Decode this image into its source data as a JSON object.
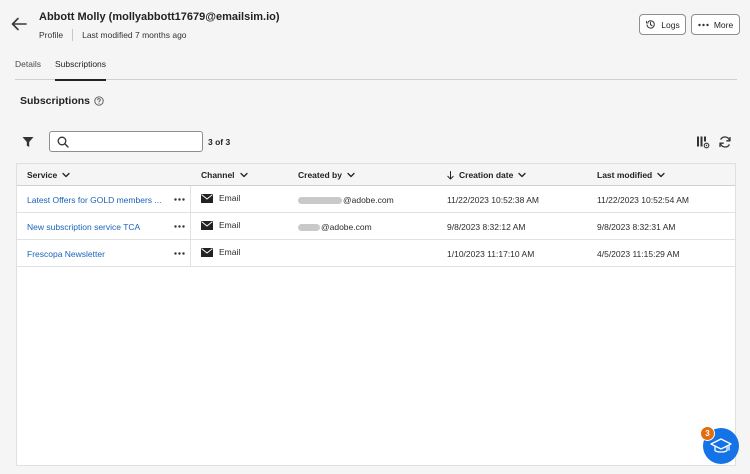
{
  "header": {
    "title": "Abbott Molly (mollyabbott17679@emailsim.io)",
    "breadcrumb": "Profile",
    "last_modified": "Last modified 7 months ago",
    "logs_label": "Logs",
    "more_label": "More"
  },
  "tabs": [
    {
      "label": "Details",
      "active": false
    },
    {
      "label": "Subscriptions",
      "active": true
    }
  ],
  "section": {
    "title": "Subscriptions"
  },
  "toolbar": {
    "search_value": "",
    "search_placeholder": "",
    "count": "3 of 3"
  },
  "table": {
    "columns": [
      {
        "label": "Service",
        "sort": "none"
      },
      {
        "label": "Channel",
        "sort": "none"
      },
      {
        "label": "Created by",
        "sort": "none"
      },
      {
        "label": "Creation date",
        "sort": "descending"
      },
      {
        "label": "Last modified",
        "sort": "none"
      }
    ],
    "rows": [
      {
        "service": "Latest Offers for GOLD members ...",
        "channel": "Email",
        "created_by": "@adobe.com",
        "creation_date": "11/22/2023 10:52:38 AM",
        "last_modified": "11/22/2023 10:52:54 AM"
      },
      {
        "service": "New subscription service TCA",
        "channel": "Email",
        "created_by": "@adobe.com",
        "creation_date": "9/8/2023 8:32:12 AM",
        "last_modified": "9/8/2023 8:32:31 AM"
      },
      {
        "service": "Frescopa Newsletter",
        "channel": "Email",
        "created_by": "",
        "creation_date": "1/10/2023 11:17:10 AM",
        "last_modified": "4/5/2023 11:15:29 AM"
      }
    ]
  },
  "help_fab": {
    "badge": "3"
  },
  "icons": {
    "back": "arrow-left-icon",
    "logs": "clock-history-icon",
    "more": "ellipsis-icon",
    "info": "help-circle-icon",
    "filter": "funnel-icon",
    "search": "magnifier-icon",
    "column_settings": "column-settings-icon",
    "refresh": "refresh-icon",
    "email": "envelope-icon",
    "help": "graduation-cap-icon"
  },
  "colors": {
    "link": "#1a63b8",
    "fab": "#1473e6",
    "badge": "#e16d0e",
    "background": "#f5f5f5"
  }
}
